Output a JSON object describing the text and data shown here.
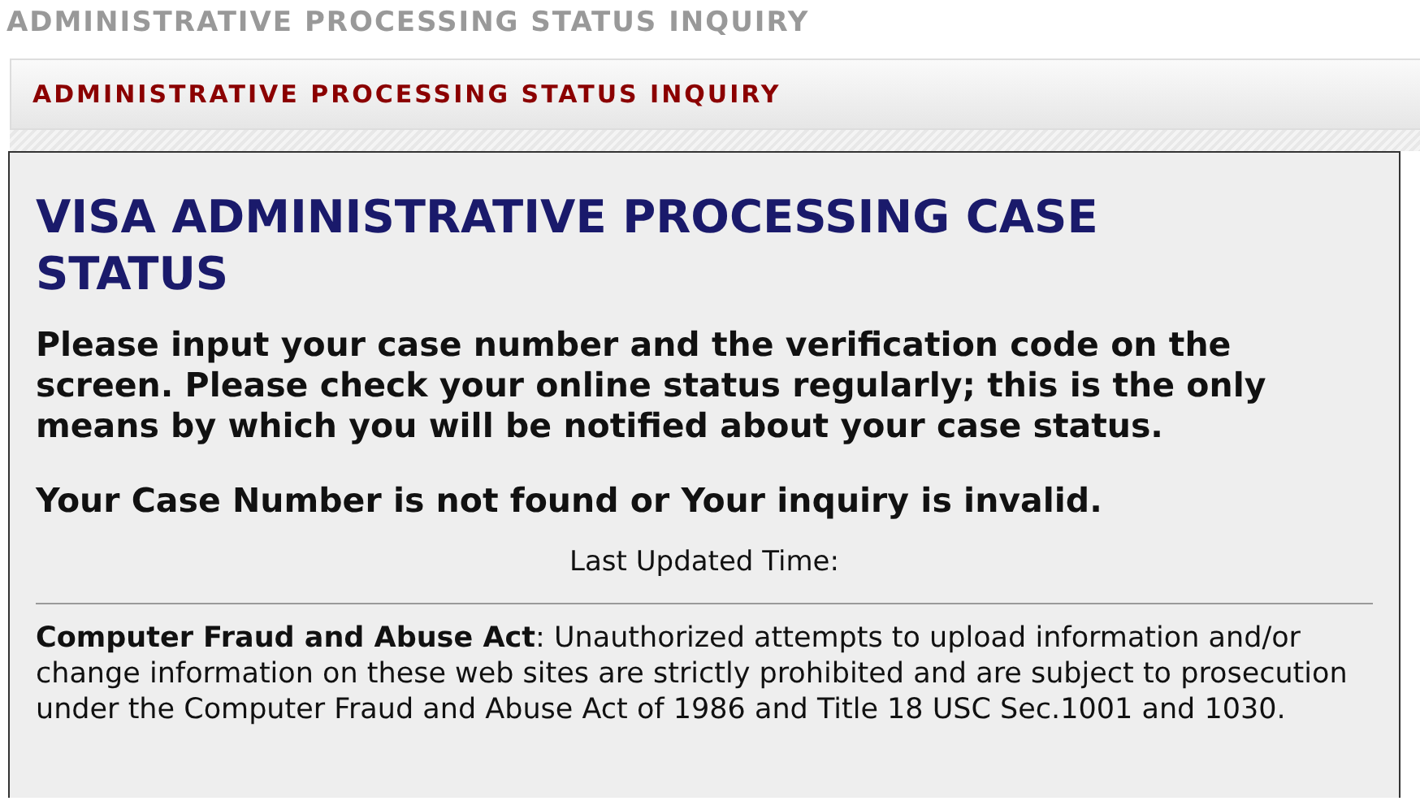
{
  "page_title": "ADMINISTRATIVE PROCESSING STATUS INQUIRY",
  "panel_header": "ADMINISTRATIVE PROCESSING STATUS INQUIRY",
  "heading": "VISA ADMINISTRATIVE PROCESSING CASE STATUS",
  "instructions": "Please input your case number and the verification code on the screen. Please check your online status regularly; this is the only means by which you will be notified about your case status.",
  "result_message": "Your Case Number is not found or Your inquiry is invalid.",
  "last_updated_label": "Last Updated Time:",
  "notice": "**Computer Fraud and Abuse Act**: Unauthorized attempts to upload information and/or change information on these web sites are strictly prohibited and are subject to prosecution under the Computer Fraud and Abuse Act of 1986 and Title 18 USC Sec.1001 and 1030."
}
